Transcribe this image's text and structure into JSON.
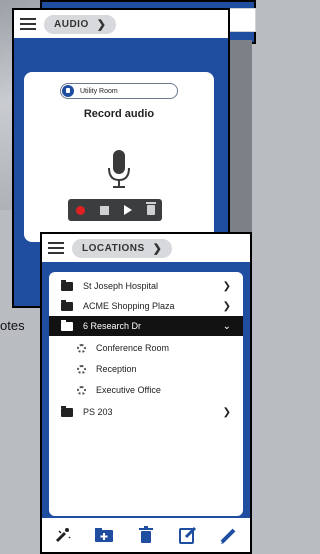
{
  "background": {
    "partial_text": "otes"
  },
  "audio_screen": {
    "breadcrumb": "AUDIO",
    "room_selector": "Utility Room",
    "title": "Record audio",
    "controls": [
      "record-icon",
      "stop-icon",
      "play-icon",
      "trash-icon"
    ]
  },
  "locations_screen": {
    "breadcrumb": "LOCATIONS",
    "items": [
      {
        "label": "St Joseph Hospital",
        "level": 0,
        "expanded": false
      },
      {
        "label": "ACME Shopping Plaza",
        "level": 0,
        "expanded": false
      },
      {
        "label": "6 Research Dr",
        "level": 0,
        "expanded": true,
        "selected": true
      },
      {
        "label": "Conference Room",
        "level": 1
      },
      {
        "label": "Reception",
        "level": 1
      },
      {
        "label": "Executive Office",
        "level": 1
      },
      {
        "label": "PS 203",
        "level": 0,
        "expanded": false
      }
    ],
    "toolbar": [
      "magic-wand-icon",
      "add-folder-icon",
      "trash-icon",
      "edit-icon",
      "pencil-icon"
    ]
  },
  "colors": {
    "brand_blue": "#1f4ea0",
    "record_red": "#e02020",
    "selected_row": "#121212"
  }
}
